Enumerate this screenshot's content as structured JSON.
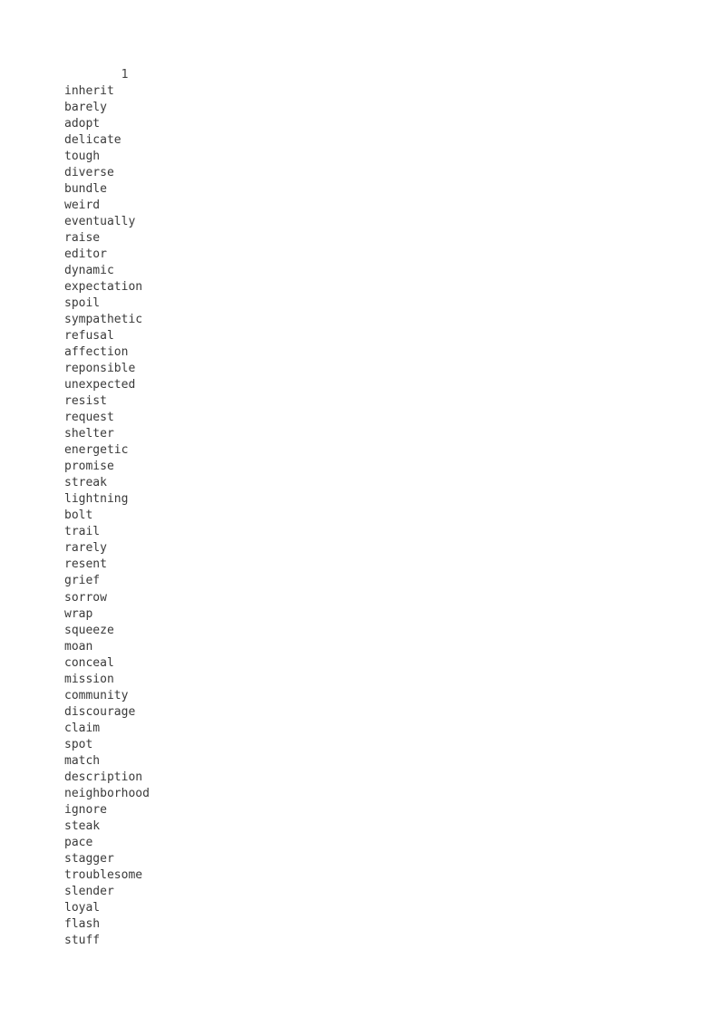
{
  "document": {
    "page_number": "1",
    "page_number_indent": "        ",
    "word_count_visible": 53
  },
  "words": [
    "inherit",
    "barely",
    "adopt",
    "delicate",
    "tough",
    "diverse",
    "bundle",
    "weird",
    "eventually",
    "raise",
    "editor",
    "dynamic",
    "expectation",
    "spoil",
    "sympathetic",
    "refusal",
    "affection",
    "reponsible",
    "unexpected",
    "resist",
    "request",
    "shelter",
    "energetic",
    "promise",
    "streak",
    "lightning",
    "bolt",
    "trail",
    "rarely",
    "resent",
    "grief",
    "sorrow",
    "wrap",
    "squeeze",
    "moan",
    "conceal",
    "mission",
    "community",
    "discourage",
    "claim",
    "spot",
    "match",
    "description",
    "neighborhood",
    "ignore",
    "steak",
    "pace",
    "stagger",
    "troublesome",
    "slender",
    "loyal",
    "flash",
    "stuff"
  ],
  "colors": {
    "page_background": "#ffffff",
    "body_text": "#3a3a3a",
    "page_number_text": "#434343"
  }
}
